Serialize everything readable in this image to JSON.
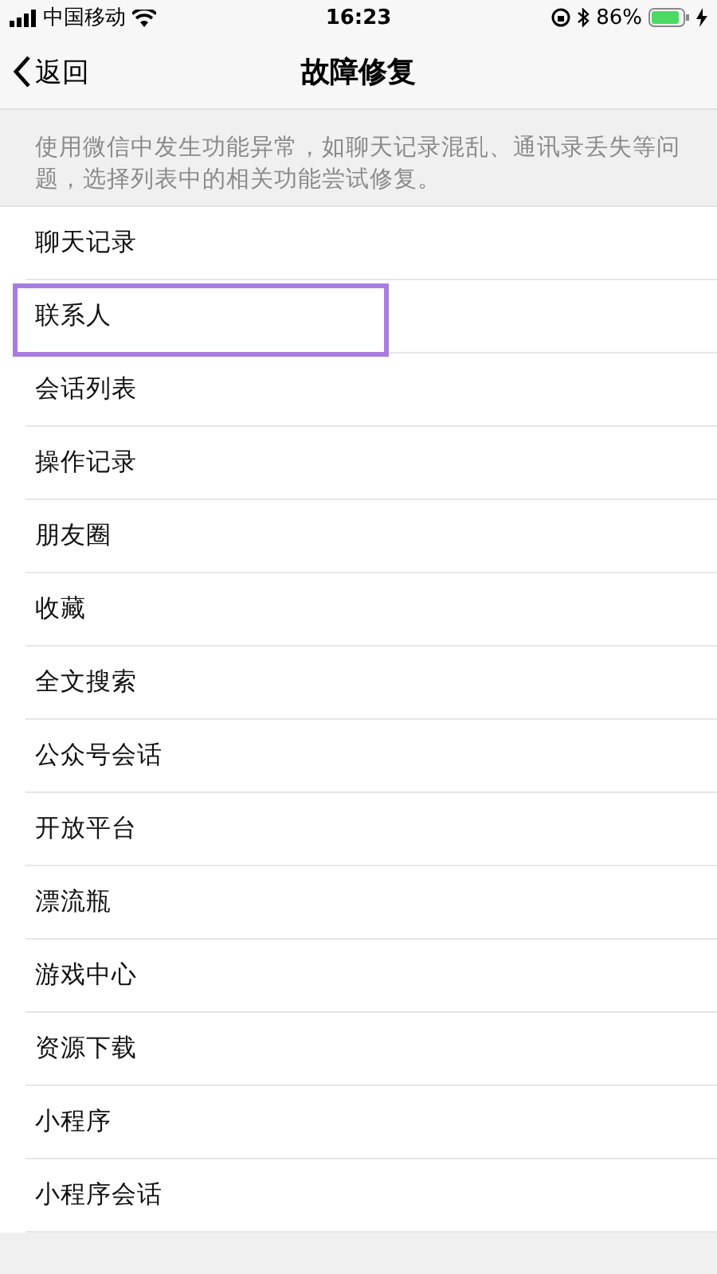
{
  "status_bar": {
    "carrier": "中国移动",
    "time": "16:23",
    "battery": "86%"
  },
  "nav": {
    "back": "返回",
    "title": "故障修复"
  },
  "description": "使用微信中发生功能异常，如聊天记录混乱、通讯录丢失等问题，选择列表中的相关功能尝试修复。",
  "items": [
    {
      "label": "聊天记录",
      "highlighted": false
    },
    {
      "label": "联系人",
      "highlighted": true
    },
    {
      "label": "会话列表",
      "highlighted": false
    },
    {
      "label": "操作记录",
      "highlighted": false
    },
    {
      "label": "朋友圈",
      "highlighted": false
    },
    {
      "label": "收藏",
      "highlighted": false
    },
    {
      "label": "全文搜索",
      "highlighted": false
    },
    {
      "label": "公众号会话",
      "highlighted": false
    },
    {
      "label": "开放平台",
      "highlighted": false
    },
    {
      "label": "漂流瓶",
      "highlighted": false
    },
    {
      "label": "游戏中心",
      "highlighted": false
    },
    {
      "label": "资源下载",
      "highlighted": false
    },
    {
      "label": "小程序",
      "highlighted": false
    },
    {
      "label": "小程序会话",
      "highlighted": false
    }
  ]
}
